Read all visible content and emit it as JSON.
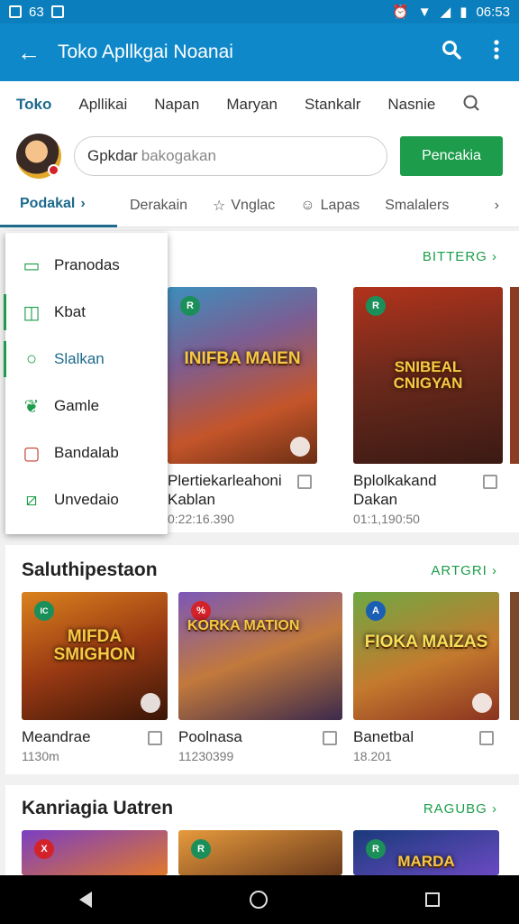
{
  "status": {
    "left_text": "63",
    "time": "06:53"
  },
  "appbar": {
    "title": "Toko Apllkgai Noanai"
  },
  "tabs": [
    "Toko",
    "Apllikai",
    "Napan",
    "Maryan",
    "Stankalr",
    "Nasnie"
  ],
  "search": {
    "value": "Gpkdar",
    "placeholder": "bakogakan",
    "button": "Pencakia"
  },
  "categories": [
    "Podakal",
    "Derakain",
    "Vnglac",
    "Lapas",
    "Smalalers"
  ],
  "menu": [
    "Pranodas",
    "Kbat",
    "Slalkan",
    "Gamle",
    "Bandalab",
    "Unvedaio"
  ],
  "sections": [
    {
      "more": "BITTERG",
      "cards": [
        {
          "art_text": "INIFBA MAIEN",
          "name": "Plertiekarleahoni Kablan",
          "meta": "0:22:16.390",
          "badge": "R",
          "badge_color": "#1b8f5a"
        },
        {
          "art_text": "SNIBEAL CNIGYAN",
          "name": "Bplolkakand Dakan",
          "meta": "01:1,190:50",
          "badge": "R",
          "badge_color": "#1b8f5a"
        }
      ]
    },
    {
      "title": "Saluthipestaon",
      "more": "ARTGRI",
      "cards": [
        {
          "art_text": "MIFDA SMIGHON",
          "name": "Meandrae",
          "meta": "1130m",
          "badge": "IC",
          "badge_color": "#1b8f5a"
        },
        {
          "art_text": "KORKA MATION",
          "name": "Poolnasa",
          "meta": "11230399",
          "badge": "%",
          "badge_color": "#d3222a"
        },
        {
          "art_text": "FIOKA MAIZAS",
          "name": "Banetbal",
          "meta": "18.201",
          "badge": "A",
          "badge_color": "#1a5fb4"
        }
      ]
    },
    {
      "title": "Kanriagia Uatren",
      "more": "RAGUBG",
      "cards": [
        {
          "badge": "X",
          "badge_color": "#d3222a"
        },
        {
          "badge": "R",
          "badge_color": "#1b8f5a"
        },
        {
          "art_text": "MARDA",
          "badge": "R",
          "badge_color": "#1b8f5a"
        }
      ]
    }
  ],
  "colors": {
    "appbar": "#0f88c9",
    "accent": "#1d9d4b",
    "tab_active": "#1c6a8c"
  }
}
